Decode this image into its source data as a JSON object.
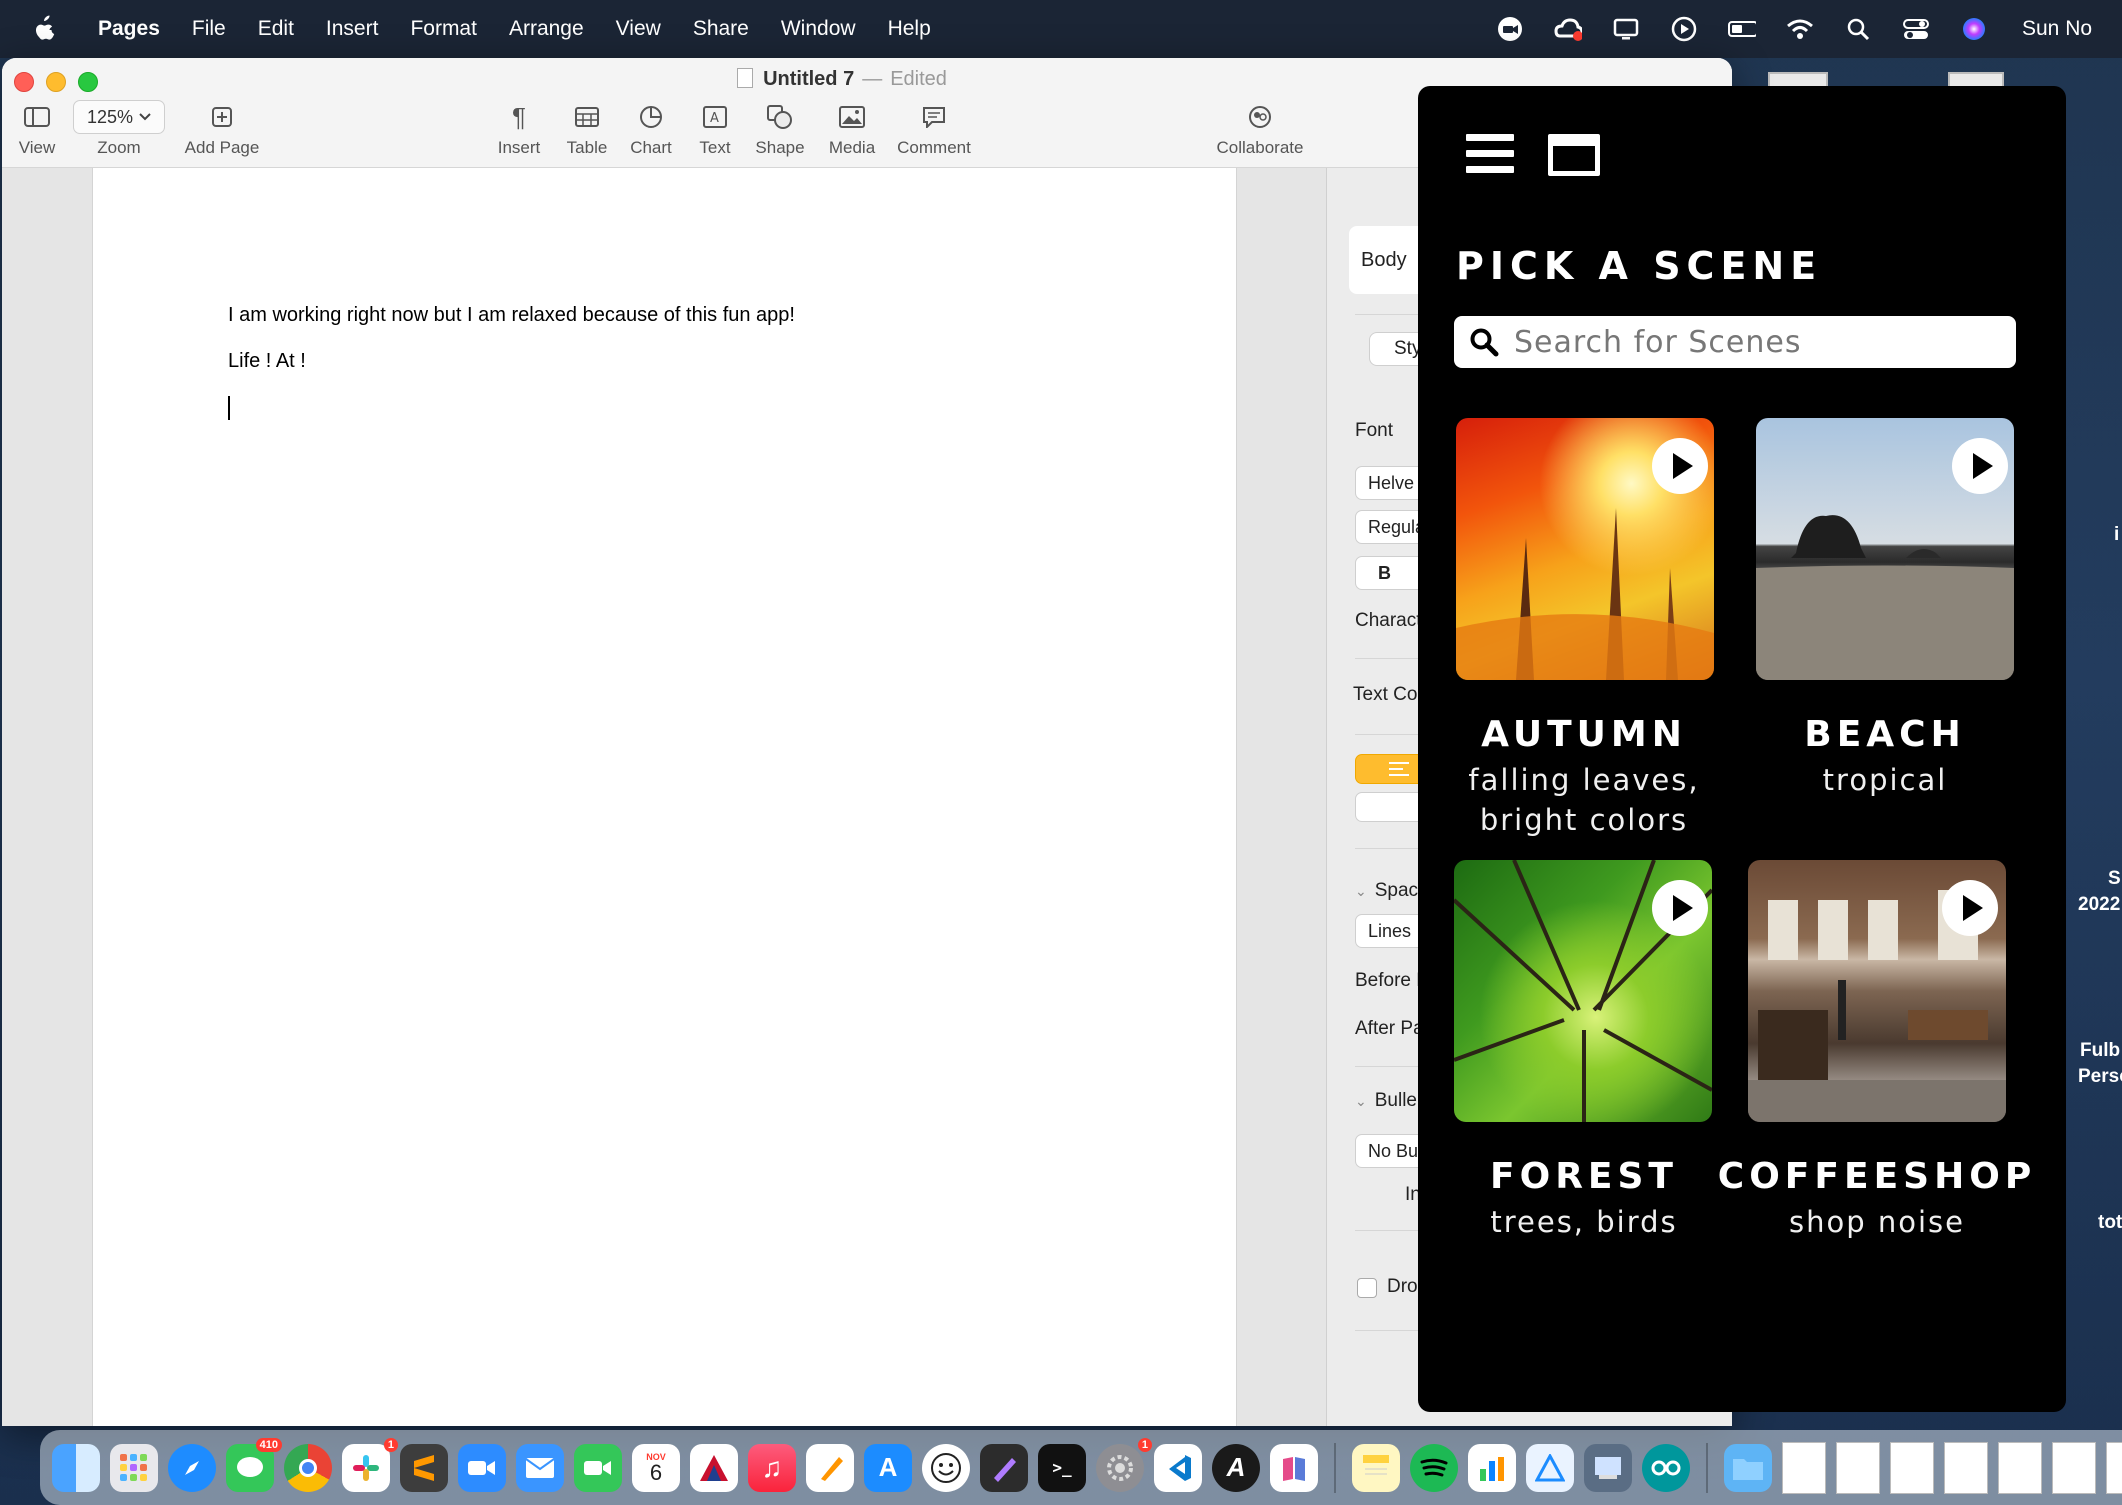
{
  "menubar": {
    "app_name": "Pages",
    "items": [
      "File",
      "Edit",
      "Insert",
      "Format",
      "Arrange",
      "View",
      "Share",
      "Window",
      "Help"
    ],
    "clock": "Sun No"
  },
  "window": {
    "title": "Untitled 7",
    "status": "Edited",
    "toolbar": {
      "view": "View",
      "zoom_value": "125%",
      "zoom": "Zoom",
      "add_page": "Add Page",
      "insert": "Insert",
      "table": "Table",
      "chart": "Chart",
      "text": "Text",
      "shape": "Shape",
      "media": "Media",
      "comment": "Comment",
      "collaborate": "Collaborate"
    }
  },
  "document": {
    "line1": "I am working right now but I am relaxed because of this fun app!",
    "line2": "Life ! At !"
  },
  "inspector": {
    "paragraph_style": "Body",
    "style_button": "Sty",
    "font_label": "Font",
    "font_name": "Helve",
    "font_weight": "Regula",
    "bold": "B",
    "character": "Charact",
    "text_color": "Text Col",
    "spacing": "Spac",
    "lines": "Lines",
    "before": "Before P",
    "after": "After Pa",
    "bullets": "Bulle",
    "no_bullets": "No Bu",
    "indent": "In",
    "drop_cap": "Dro"
  },
  "scene_app": {
    "heading": "PICK A SCENE",
    "search_placeholder": "Search for Scenes",
    "scenes": [
      {
        "title": "AUTUMN",
        "subtitle_1": "falling leaves,",
        "subtitle_2": "bright colors"
      },
      {
        "title": "BEACH",
        "subtitle_1": "tropical",
        "subtitle_2": ""
      },
      {
        "title": "FOREST",
        "subtitle_1": "trees, birds",
        "subtitle_2": ""
      },
      {
        "title": "COFFEESHOP",
        "subtitle_1": "shop noise",
        "subtitle_2": ""
      }
    ]
  },
  "desktop_labels": {
    "a": "i",
    "b": "S",
    "c": "2022",
    "d": "Fulb",
    "e": "Perso",
    "f": "tot"
  },
  "dock": {
    "messages_badge": "410",
    "slack_badge": "1",
    "calendar_month": "NOV",
    "calendar_day": "6",
    "settings_badge": "1"
  },
  "colors": {
    "accent": "#febc2e",
    "scene_bg": "#000000",
    "menubar_bg": "#1b2535"
  }
}
